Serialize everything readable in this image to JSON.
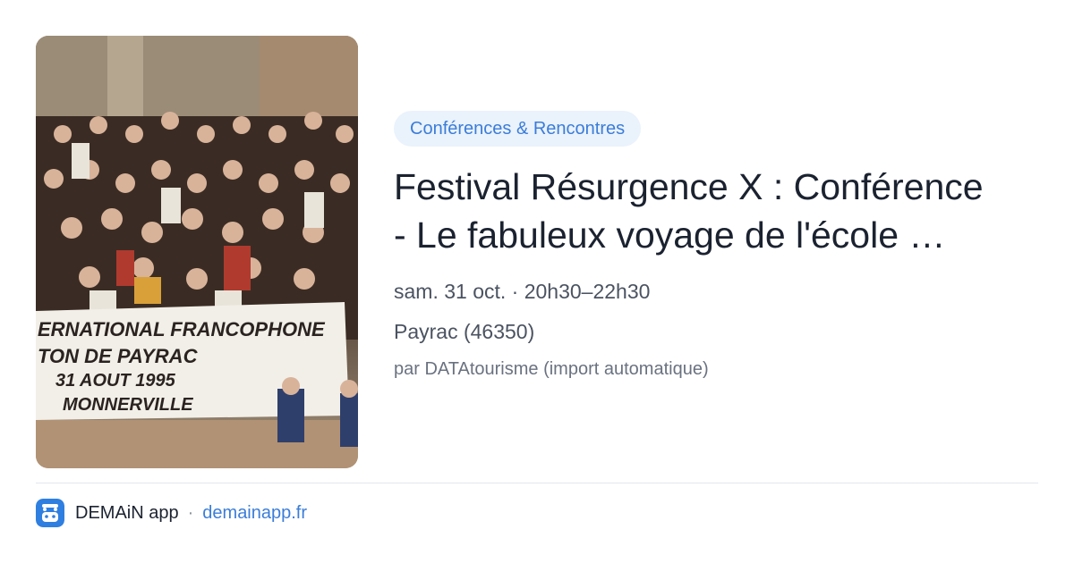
{
  "card": {
    "image_alt": "Group photo with banner",
    "image_banner_lines": [
      "ERNATIONAL FRANCOPHONE",
      "TON DE PAYRAC",
      "31 AOUT 1995",
      "MONNERVILLE"
    ],
    "category": "Conférences & Rencontres",
    "title_line1": "Festival Résurgence X : Conférence",
    "title_line2": "- Le fabuleux voyage de l'école …",
    "date": "sam. 31 oct. · 20h30–22h30",
    "location": "Payrac (46350)",
    "source": "par DATAtourisme (import automatique)"
  },
  "footer": {
    "app_name": "DEMAiN app",
    "separator": "·",
    "url": "demainapp.fr",
    "icon": "demain-app-icon"
  },
  "colors": {
    "accent": "#3b7dd8",
    "chip_bg": "#eaf2fc",
    "title": "#1b2230",
    "meta": "#4b5361",
    "divider": "#e4e7eb"
  }
}
